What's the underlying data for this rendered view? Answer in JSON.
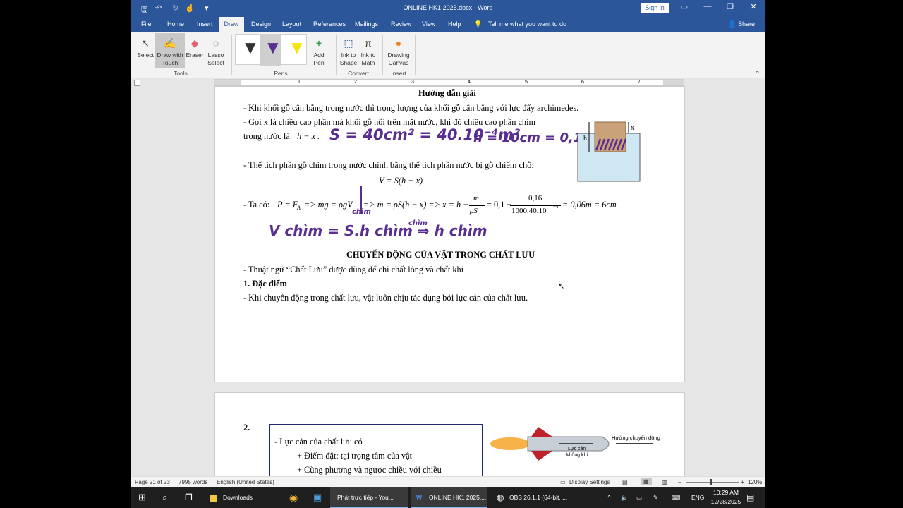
{
  "window": {
    "title": "ONLINE HK1 2025.docx - Word",
    "sign_in": "Sign in",
    "share": "Share"
  },
  "tabs": [
    "File",
    "Home",
    "Insert",
    "Draw",
    "Design",
    "Layout",
    "References",
    "Mailings",
    "Review",
    "View",
    "Help"
  ],
  "tell_me": "Tell me what you want to do",
  "ribbon": {
    "select": "Select",
    "draw_touch_1": "Draw with",
    "draw_touch_2": "Touch",
    "eraser": "Eraser",
    "lasso_1": "Lasso",
    "lasso_2": "Select",
    "tools_group": "Tools",
    "add_pen_1": "Add",
    "add_pen_2": "Pen",
    "pens_group": "Pens",
    "ink_shape_1": "Ink to",
    "ink_shape_2": "Shape",
    "ink_math_1": "Ink to",
    "ink_math_2": "Math",
    "convert_group": "Convert",
    "canvas_1": "Drawing",
    "canvas_2": "Canvas",
    "insert_group": "Insert"
  },
  "ruler_numbers": [
    "1",
    "1",
    "2",
    "3",
    "4",
    "5",
    "6",
    "7"
  ],
  "page1": {
    "heading": "Hướng dẫn giải",
    "line1": "- Khi khối gỗ cân bằng trong nước thì trọng lượng của khối gỗ cân bằng với lực đẩy archimedes.",
    "line2": "- Gọi x là chiều cao phần mà khối gỗ nổi trên mặt nước, khi đó chiều cao phần chìm",
    "line3a": "trong nước là",
    "line3b": "h − x .",
    "line4": "- Thể tích phần gỗ chìm trong nước chính bằng thể tích phần nước bị gỗ chiếm chỗ:",
    "formula_v": "V = S(h − x)",
    "line5a": "- Ta có:",
    "line5b": "P = F",
    "line5sub": "A",
    "line5c": "=> mg = ρgV",
    "line5d": "=> m = ρS(h − x) => x = h −",
    "frac1_num": "m",
    "frac1_den": "ρS",
    "line5e": "= 0,1 −",
    "frac2_num": "0,16",
    "frac2_den": "1000.40.10",
    "frac2_exp": "−4",
    "line5f": "= 0,06m = 6cm",
    "hw1": "S = 40cm² = 40.10⁻⁴m²",
    "hw2": "h = 10cm = 0,1 m",
    "hw3": "chìm",
    "hw4": "chìm",
    "hw5": "V chìm = S.h chìm ⇒ h chìm",
    "fig_h": "h",
    "fig_x": "x",
    "section_title": "CHUYỂN ĐỘNG CỦA VẬT TRONG CHẤT LƯU",
    "line6": "- Thuật ngữ “Chất Lưu” được dùng để chỉ chất lỏng và chất khí",
    "sub1": "1. Đặc điểm",
    "line7": "- Khi chuyển động trong chất lưu, vật luôn chịu tác dụng bởi lực cản của chất lưu."
  },
  "page2": {
    "num": "2.",
    "box1": "- Lực cản của chất lưu có",
    "box2": "+ Điểm đặt: tại trọng tâm của vật",
    "box3": "+ Cùng phương và ngược chiều với chiều",
    "rocket_label1": "Lực cản",
    "rocket_label2": "không khí",
    "rocket_dir": "Hướng chuyển động"
  },
  "status": {
    "page": "Page 21 of 23",
    "words": "7995 words",
    "lang": "English (United States)",
    "display": "Display Settings",
    "zoom": "120%"
  },
  "taskbar": {
    "downloads": "Downloads",
    "chrome": "Phát trực tiếp - You...",
    "word": "ONLINE HK1 2025....",
    "obs": "OBS 26.1.1 (64-bit, ...",
    "lang": "ENG",
    "time": "10:29 AM",
    "date": "12/28/2025"
  },
  "colors": {
    "word_blue": "#2b579a",
    "ink_purple": "#5a2d91"
  }
}
